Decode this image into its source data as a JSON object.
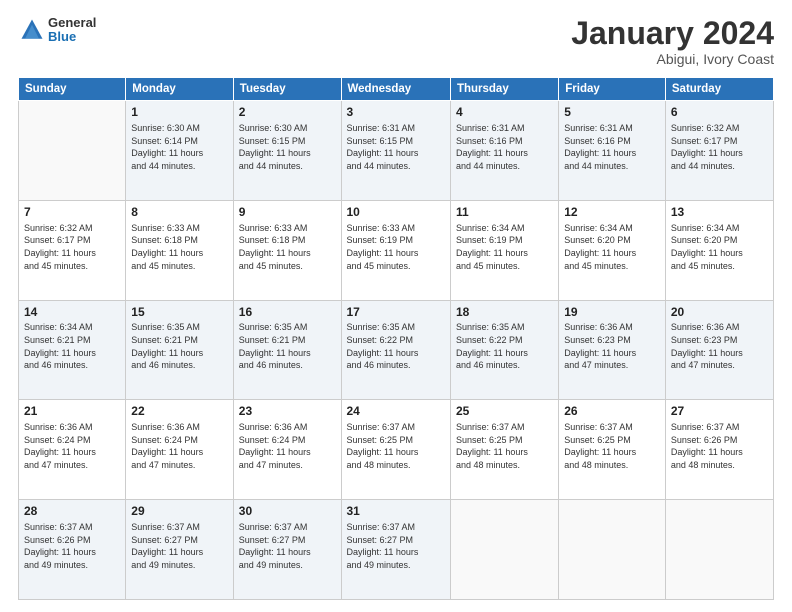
{
  "logo": {
    "general": "General",
    "blue": "Blue"
  },
  "header": {
    "month": "January 2024",
    "location": "Abigui, Ivory Coast"
  },
  "days_of_week": [
    "Sunday",
    "Monday",
    "Tuesday",
    "Wednesday",
    "Thursday",
    "Friday",
    "Saturday"
  ],
  "weeks": [
    [
      {
        "day": "",
        "info": ""
      },
      {
        "day": "1",
        "info": "Sunrise: 6:30 AM\nSunset: 6:14 PM\nDaylight: 11 hours\nand 44 minutes."
      },
      {
        "day": "2",
        "info": "Sunrise: 6:30 AM\nSunset: 6:15 PM\nDaylight: 11 hours\nand 44 minutes."
      },
      {
        "day": "3",
        "info": "Sunrise: 6:31 AM\nSunset: 6:15 PM\nDaylight: 11 hours\nand 44 minutes."
      },
      {
        "day": "4",
        "info": "Sunrise: 6:31 AM\nSunset: 6:16 PM\nDaylight: 11 hours\nand 44 minutes."
      },
      {
        "day": "5",
        "info": "Sunrise: 6:31 AM\nSunset: 6:16 PM\nDaylight: 11 hours\nand 44 minutes."
      },
      {
        "day": "6",
        "info": "Sunrise: 6:32 AM\nSunset: 6:17 PM\nDaylight: 11 hours\nand 44 minutes."
      }
    ],
    [
      {
        "day": "7",
        "info": "Sunrise: 6:32 AM\nSunset: 6:17 PM\nDaylight: 11 hours\nand 45 minutes."
      },
      {
        "day": "8",
        "info": "Sunrise: 6:33 AM\nSunset: 6:18 PM\nDaylight: 11 hours\nand 45 minutes."
      },
      {
        "day": "9",
        "info": "Sunrise: 6:33 AM\nSunset: 6:18 PM\nDaylight: 11 hours\nand 45 minutes."
      },
      {
        "day": "10",
        "info": "Sunrise: 6:33 AM\nSunset: 6:19 PM\nDaylight: 11 hours\nand 45 minutes."
      },
      {
        "day": "11",
        "info": "Sunrise: 6:34 AM\nSunset: 6:19 PM\nDaylight: 11 hours\nand 45 minutes."
      },
      {
        "day": "12",
        "info": "Sunrise: 6:34 AM\nSunset: 6:20 PM\nDaylight: 11 hours\nand 45 minutes."
      },
      {
        "day": "13",
        "info": "Sunrise: 6:34 AM\nSunset: 6:20 PM\nDaylight: 11 hours\nand 45 minutes."
      }
    ],
    [
      {
        "day": "14",
        "info": "Sunrise: 6:34 AM\nSunset: 6:21 PM\nDaylight: 11 hours\nand 46 minutes."
      },
      {
        "day": "15",
        "info": "Sunrise: 6:35 AM\nSunset: 6:21 PM\nDaylight: 11 hours\nand 46 minutes."
      },
      {
        "day": "16",
        "info": "Sunrise: 6:35 AM\nSunset: 6:21 PM\nDaylight: 11 hours\nand 46 minutes."
      },
      {
        "day": "17",
        "info": "Sunrise: 6:35 AM\nSunset: 6:22 PM\nDaylight: 11 hours\nand 46 minutes."
      },
      {
        "day": "18",
        "info": "Sunrise: 6:35 AM\nSunset: 6:22 PM\nDaylight: 11 hours\nand 46 minutes."
      },
      {
        "day": "19",
        "info": "Sunrise: 6:36 AM\nSunset: 6:23 PM\nDaylight: 11 hours\nand 47 minutes."
      },
      {
        "day": "20",
        "info": "Sunrise: 6:36 AM\nSunset: 6:23 PM\nDaylight: 11 hours\nand 47 minutes."
      }
    ],
    [
      {
        "day": "21",
        "info": "Sunrise: 6:36 AM\nSunset: 6:24 PM\nDaylight: 11 hours\nand 47 minutes."
      },
      {
        "day": "22",
        "info": "Sunrise: 6:36 AM\nSunset: 6:24 PM\nDaylight: 11 hours\nand 47 minutes."
      },
      {
        "day": "23",
        "info": "Sunrise: 6:36 AM\nSunset: 6:24 PM\nDaylight: 11 hours\nand 47 minutes."
      },
      {
        "day": "24",
        "info": "Sunrise: 6:37 AM\nSunset: 6:25 PM\nDaylight: 11 hours\nand 48 minutes."
      },
      {
        "day": "25",
        "info": "Sunrise: 6:37 AM\nSunset: 6:25 PM\nDaylight: 11 hours\nand 48 minutes."
      },
      {
        "day": "26",
        "info": "Sunrise: 6:37 AM\nSunset: 6:25 PM\nDaylight: 11 hours\nand 48 minutes."
      },
      {
        "day": "27",
        "info": "Sunrise: 6:37 AM\nSunset: 6:26 PM\nDaylight: 11 hours\nand 48 minutes."
      }
    ],
    [
      {
        "day": "28",
        "info": "Sunrise: 6:37 AM\nSunset: 6:26 PM\nDaylight: 11 hours\nand 49 minutes."
      },
      {
        "day": "29",
        "info": "Sunrise: 6:37 AM\nSunset: 6:27 PM\nDaylight: 11 hours\nand 49 minutes."
      },
      {
        "day": "30",
        "info": "Sunrise: 6:37 AM\nSunset: 6:27 PM\nDaylight: 11 hours\nand 49 minutes."
      },
      {
        "day": "31",
        "info": "Sunrise: 6:37 AM\nSunset: 6:27 PM\nDaylight: 11 hours\nand 49 minutes."
      },
      {
        "day": "",
        "info": ""
      },
      {
        "day": "",
        "info": ""
      },
      {
        "day": "",
        "info": ""
      }
    ]
  ]
}
